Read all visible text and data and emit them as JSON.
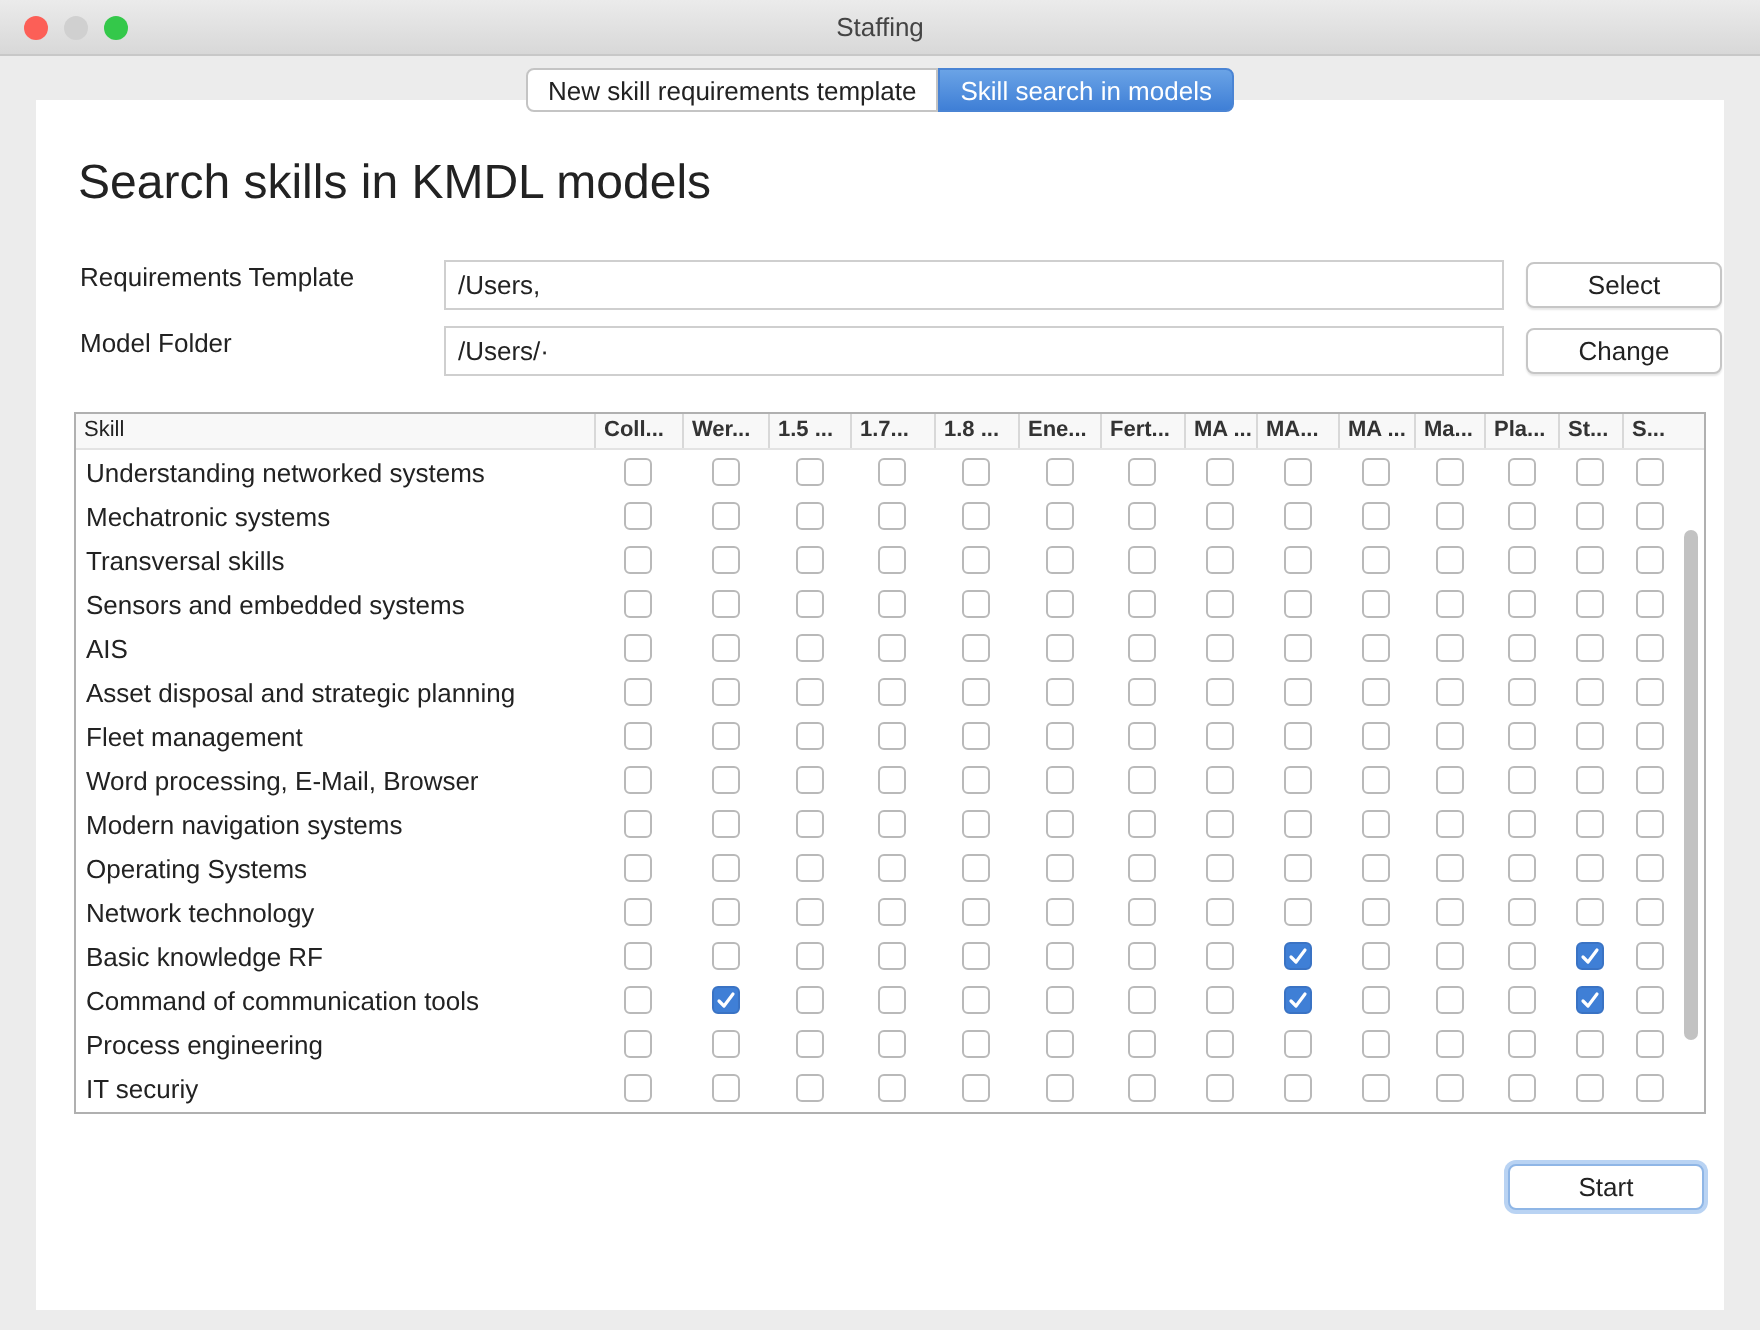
{
  "window": {
    "title": "Staffing"
  },
  "tabs": [
    {
      "label": "New skill requirements template",
      "selected": false
    },
    {
      "label": "Skill search in models",
      "selected": true
    }
  ],
  "heading": "Search skills in KMDL models",
  "fields": [
    {
      "label": "Requirements Template",
      "value": "/Users,",
      "button": "Select"
    },
    {
      "label": "Model Folder",
      "value": "/Users/·",
      "button": "Change"
    }
  ],
  "table": {
    "columns": [
      "Skill",
      "Coll...",
      "Wer...",
      "1.5 ...",
      "1.7...",
      "1.8 ...",
      "Ene...",
      "Fert...",
      "MA ...",
      "MA...",
      "MA ...",
      "Ma...",
      "Pla...",
      "St...",
      "S..."
    ],
    "rows": [
      {
        "skill": "Understanding networked systems",
        "checks": [
          false,
          false,
          false,
          false,
          false,
          false,
          false,
          false,
          false,
          false,
          false,
          false,
          false,
          false
        ]
      },
      {
        "skill": "Mechatronic systems",
        "checks": [
          false,
          false,
          false,
          false,
          false,
          false,
          false,
          false,
          false,
          false,
          false,
          false,
          false,
          false
        ]
      },
      {
        "skill": "Transversal skills",
        "checks": [
          false,
          false,
          false,
          false,
          false,
          false,
          false,
          false,
          false,
          false,
          false,
          false,
          false,
          false
        ]
      },
      {
        "skill": "Sensors and embedded systems",
        "checks": [
          false,
          false,
          false,
          false,
          false,
          false,
          false,
          false,
          false,
          false,
          false,
          false,
          false,
          false
        ]
      },
      {
        "skill": "AIS",
        "checks": [
          false,
          false,
          false,
          false,
          false,
          false,
          false,
          false,
          false,
          false,
          false,
          false,
          false,
          false
        ]
      },
      {
        "skill": "Asset disposal and strategic planning",
        "checks": [
          false,
          false,
          false,
          false,
          false,
          false,
          false,
          false,
          false,
          false,
          false,
          false,
          false,
          false
        ]
      },
      {
        "skill": "Fleet management",
        "checks": [
          false,
          false,
          false,
          false,
          false,
          false,
          false,
          false,
          false,
          false,
          false,
          false,
          false,
          false
        ]
      },
      {
        "skill": "Word processing, E-Mail, Browser",
        "checks": [
          false,
          false,
          false,
          false,
          false,
          false,
          false,
          false,
          false,
          false,
          false,
          false,
          false,
          false
        ]
      },
      {
        "skill": "Modern navigation systems",
        "checks": [
          false,
          false,
          false,
          false,
          false,
          false,
          false,
          false,
          false,
          false,
          false,
          false,
          false,
          false
        ]
      },
      {
        "skill": "Operating Systems",
        "checks": [
          false,
          false,
          false,
          false,
          false,
          false,
          false,
          false,
          false,
          false,
          false,
          false,
          false,
          false
        ]
      },
      {
        "skill": "Network technology",
        "checks": [
          false,
          false,
          false,
          false,
          false,
          false,
          false,
          false,
          false,
          false,
          false,
          false,
          false,
          false
        ]
      },
      {
        "skill": "Basic knowledge RF",
        "checks": [
          false,
          false,
          false,
          false,
          false,
          false,
          false,
          false,
          true,
          false,
          false,
          false,
          true,
          false
        ]
      },
      {
        "skill": "Command of communication tools",
        "checks": [
          false,
          true,
          false,
          false,
          false,
          false,
          false,
          false,
          true,
          false,
          false,
          false,
          true,
          false
        ]
      },
      {
        "skill": "Process engineering",
        "checks": [
          false,
          false,
          false,
          false,
          false,
          false,
          false,
          false,
          false,
          false,
          false,
          false,
          false,
          false
        ]
      },
      {
        "skill": "IT securiy",
        "checks": [
          false,
          false,
          false,
          false,
          false,
          false,
          false,
          false,
          false,
          false,
          false,
          false,
          false,
          false
        ]
      }
    ]
  },
  "start_button": "Start"
}
